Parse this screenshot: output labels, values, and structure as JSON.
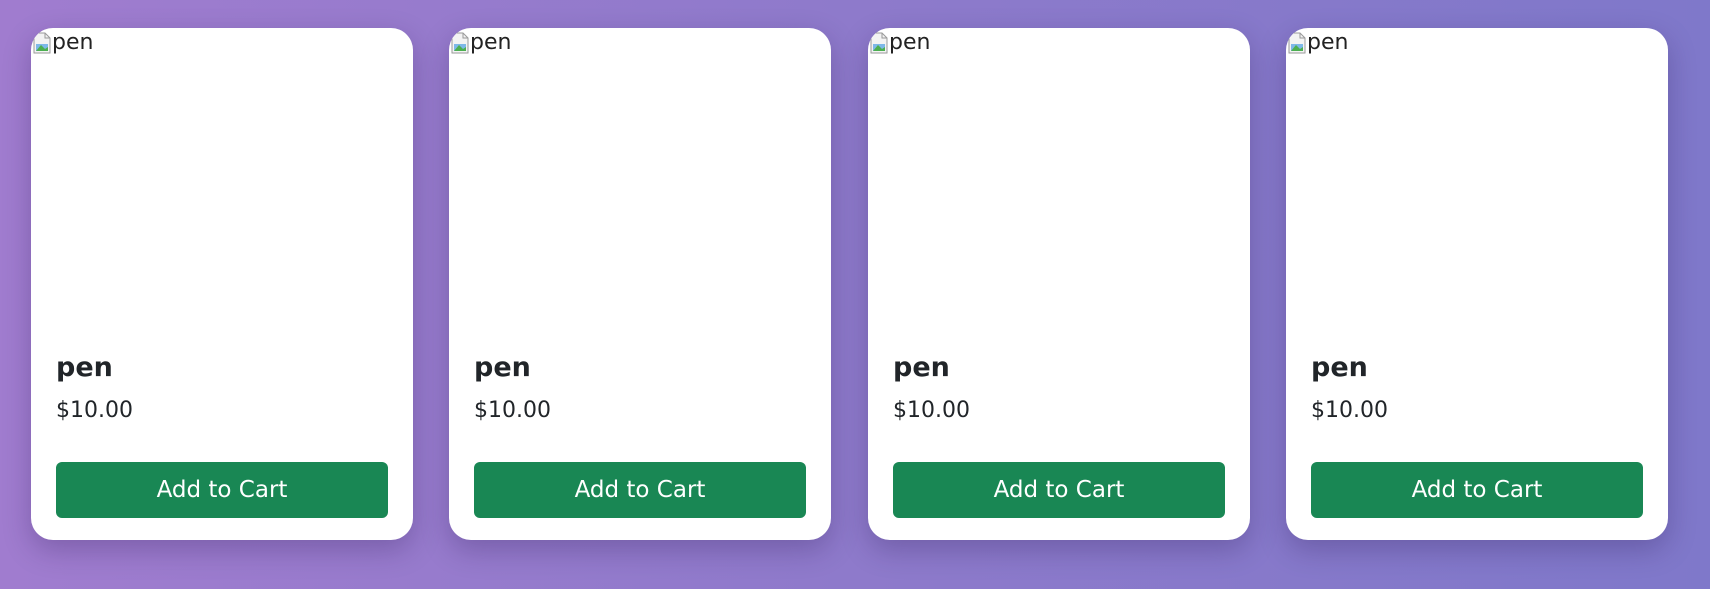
{
  "products": [
    {
      "image_alt": "pen",
      "name": "pen",
      "price": "$10.00",
      "button_label": "Add to Cart"
    },
    {
      "image_alt": "pen",
      "name": "pen",
      "price": "$10.00",
      "button_label": "Add to Cart"
    },
    {
      "image_alt": "pen",
      "name": "pen",
      "price": "$10.00",
      "button_label": "Add to Cart"
    },
    {
      "image_alt": "pen",
      "name": "pen",
      "price": "$10.00",
      "button_label": "Add to Cart"
    }
  ],
  "icons": {
    "product_image": "broken-image-icon"
  },
  "colors": {
    "button_bg": "#198754",
    "button_text": "#ffffff",
    "card_bg": "#ffffff",
    "page_gradient_start": "#a07ccf",
    "page_gradient_end": "#7f78ca"
  }
}
